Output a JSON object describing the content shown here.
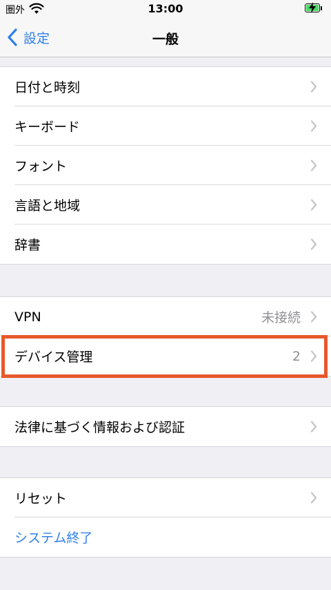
{
  "status": {
    "carrier": "圏外",
    "time": "13:00"
  },
  "nav": {
    "back_label": "設定",
    "title": "一般"
  },
  "group1": [
    {
      "label": "日付と時刻"
    },
    {
      "label": "キーボード"
    },
    {
      "label": "フォント"
    },
    {
      "label": "言語と地域"
    },
    {
      "label": "辞書"
    }
  ],
  "group2": [
    {
      "label": "VPN",
      "value": "未接続"
    },
    {
      "label": "デバイス管理",
      "value": "2"
    }
  ],
  "group3": [
    {
      "label": "法律に基づく情報および認証"
    }
  ],
  "group4": [
    {
      "label": "リセット"
    },
    {
      "label": "システム終了"
    }
  ],
  "colors": {
    "accent": "#2f80ed",
    "highlight": "#e7582b",
    "background": "#efeff4"
  }
}
